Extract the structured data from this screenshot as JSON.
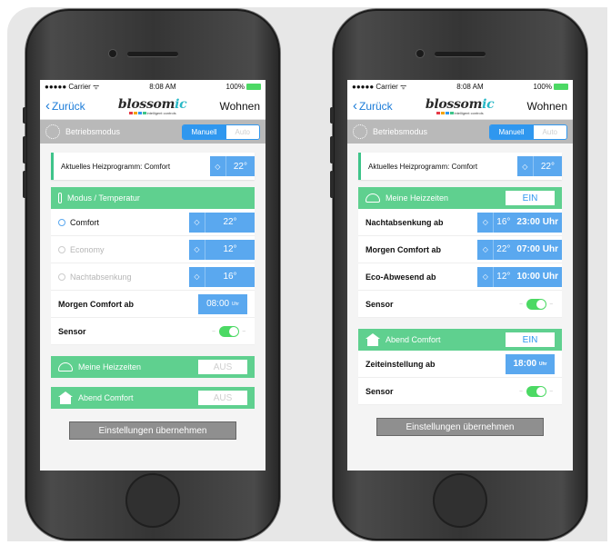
{
  "status": {
    "carrier": "●●●●● Carrier ᯤ",
    "time": "8:08 AM",
    "battery": "100%"
  },
  "nav": {
    "back": "Zurück",
    "logo": "blossom",
    "logo_suffix": "ic",
    "logo_tag": "intelligent controls",
    "room": "Wohnen"
  },
  "mode": {
    "label": "Betriebsmodus",
    "manual": "Manuell",
    "auto": "Auto"
  },
  "left": {
    "current": {
      "label": "Aktuelles Heizprogramm: Comfort",
      "value": "22°"
    },
    "section_temp": {
      "title": "Modus / Temperatur"
    },
    "rows": [
      {
        "label": "Comfort",
        "value": "22°"
      },
      {
        "label": "Economy",
        "value": "12°"
      },
      {
        "label": "Nachtabsenkung",
        "value": "16°"
      }
    ],
    "morning": {
      "label": "Morgen Comfort ab",
      "time": "08:00",
      "unit": "Uhr"
    },
    "sensor": {
      "label": "Sensor"
    },
    "heizzeiten": {
      "title": "Meine Heizzeiten",
      "state": "AUS"
    },
    "abend": {
      "title": "Abend Comfort",
      "state": "AUS"
    },
    "apply": "Einstellungen übernehmen"
  },
  "right": {
    "current": {
      "label": "Aktuelles Heizprogramm: Comfort",
      "value": "22°"
    },
    "heizzeiten": {
      "title": "Meine Heizzeiten",
      "state": "EIN"
    },
    "rows": [
      {
        "label": "Nachtabsenkung ab",
        "temp": "16°",
        "time": "23:00 Uhr"
      },
      {
        "label": "Morgen Comfort ab",
        "temp": "22°",
        "time": "07:00 Uhr"
      },
      {
        "label": "Eco-Abwesend ab",
        "temp": "12°",
        "time": "10:00 Uhr"
      }
    ],
    "sensor": {
      "label": "Sensor"
    },
    "abend": {
      "title": "Abend Comfort",
      "state": "EIN"
    },
    "zeit": {
      "label": "Zeiteinstellung ab",
      "time": "18:00",
      "unit": "Uhr"
    },
    "sensor2": {
      "label": "Sensor"
    },
    "apply": "Einstellungen übernehmen"
  },
  "colors": {
    "green": "#5fd08f",
    "blue": "#5aa8ef",
    "accent": "#2f97ef"
  },
  "icons": {
    "stepper": "up-down-chevron-icon"
  }
}
